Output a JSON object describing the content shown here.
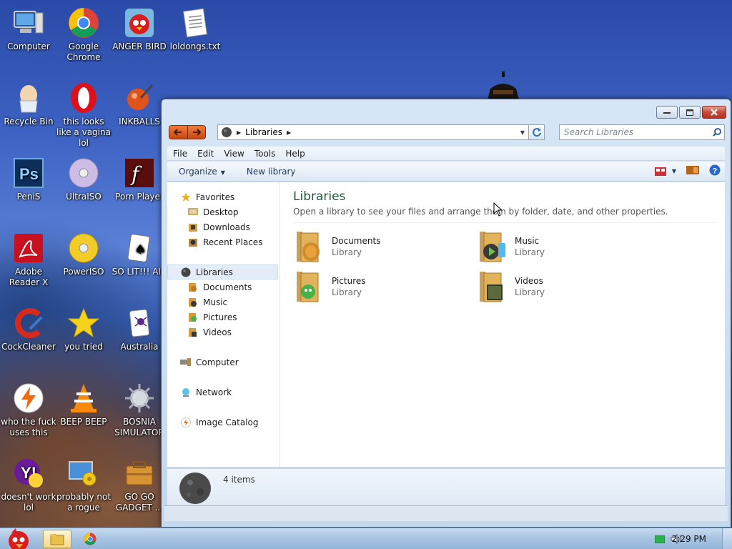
{
  "desktop": {
    "icons": [
      {
        "label": "Computer",
        "icon": "computer-icon"
      },
      {
        "label": "Google Chrome",
        "icon": "chrome-icon"
      },
      {
        "label": "ANGER BIRD",
        "icon": "angry-bird-icon"
      },
      {
        "label": "loldongs.txt",
        "icon": "text-file-icon"
      },
      {
        "label": "Recycle Bin",
        "icon": "recycle-bin-icon"
      },
      {
        "label": "this looks like a vagina lol",
        "icon": "opera-icon"
      },
      {
        "label": "INKBALLS",
        "icon": "inkball-icon"
      },
      {
        "label": "PeniS",
        "icon": "photoshop-icon"
      },
      {
        "label": "UltraISO",
        "icon": "disc-icon"
      },
      {
        "label": "Porn Player",
        "icon": "flash-icon"
      },
      {
        "label": "Adobe Reader X",
        "icon": "adobe-reader-icon"
      },
      {
        "label": "PowerISO",
        "icon": "gold-disc-icon"
      },
      {
        "label": "SO LIT!!! AIR",
        "icon": "cards-icon"
      },
      {
        "label": "CockCleaner",
        "icon": "ccleaner-icon"
      },
      {
        "label": "you tried",
        "icon": "star-icon"
      },
      {
        "label": "Australia",
        "icon": "spider-solitaire-icon"
      },
      {
        "label": "who the fuck uses this",
        "icon": "winamp-icon"
      },
      {
        "label": "BEEP BEEP",
        "icon": "vlc-icon"
      },
      {
        "label": "BOSNIA SIMULATOR",
        "icon": "minesweeper-icon"
      },
      {
        "label": "doesn't work lol",
        "icon": "yahoo-icon"
      },
      {
        "label": "probably not a rogue",
        "icon": "settings-monitor-icon"
      },
      {
        "label": "GO GO GADGET ...",
        "icon": "gadget-folder-icon"
      }
    ]
  },
  "window": {
    "address": {
      "crumb": "Libraries"
    },
    "search": {
      "placeholder": "Search Libraries"
    },
    "menu": [
      "File",
      "Edit",
      "View",
      "Tools",
      "Help"
    ],
    "toolbar": {
      "organize": "Organize",
      "new_library": "New library"
    },
    "nav": {
      "favorites": "Favorites",
      "desktop": "Desktop",
      "downloads": "Downloads",
      "recent_places": "Recent Places",
      "libraries": "Libraries",
      "documents": "Documents",
      "music": "Music",
      "pictures": "Pictures",
      "videos": "Videos",
      "computer": "Computer",
      "network": "Network",
      "image_catalog": "Image Catalog"
    },
    "content": {
      "title": "Libraries",
      "description": "Open a library to see your files and arrange them by folder, date, and other properties.",
      "libraries": [
        {
          "name": "Documents",
          "type": "Library"
        },
        {
          "name": "Music",
          "type": "Library"
        },
        {
          "name": "Pictures",
          "type": "Library"
        },
        {
          "name": "Videos",
          "type": "Library"
        }
      ]
    },
    "details": {
      "count": "4 items"
    }
  },
  "taskbar": {
    "clock": "2:29 PM"
  },
  "colors": {
    "title_green": "#1e5c33",
    "nav_orange": "#e0601f",
    "taskbar": "#a7c3e2"
  }
}
